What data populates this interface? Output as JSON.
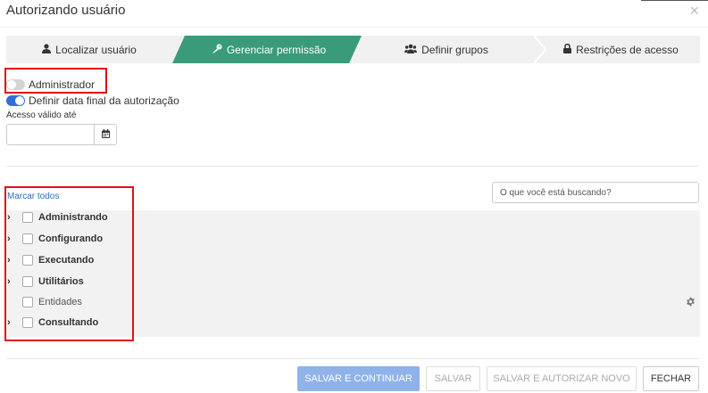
{
  "dialog": {
    "title": "Autorizando usuário",
    "close_glyph": "×"
  },
  "wizard": {
    "tabs": [
      {
        "label": "Localizar usuário",
        "icon": "user-icon",
        "active": false
      },
      {
        "label": "Gerenciar permissão",
        "icon": "key-icon",
        "active": true
      },
      {
        "label": "Definir grupos",
        "icon": "users-icon",
        "active": false
      },
      {
        "label": "Restrições de acesso",
        "icon": "lock-icon",
        "active": false
      }
    ],
    "active_color": "#3a9b7b"
  },
  "toggles": {
    "admin": {
      "label": "Administrador",
      "on": false
    },
    "end_date": {
      "label": "Definir data final da autorização",
      "on": true
    }
  },
  "valid_until": {
    "label": "Acesso válido até",
    "value": "",
    "calendar_icon": "calendar-icon"
  },
  "permissions": {
    "select_all": "Marcar todos",
    "search_placeholder": "O que você está buscando?",
    "items": [
      {
        "label": "Administrando",
        "expandable": true,
        "bold": true
      },
      {
        "label": "Configurando",
        "expandable": true,
        "bold": true
      },
      {
        "label": "Executando",
        "expandable": true,
        "bold": true
      },
      {
        "label": "Utilitários",
        "expandable": true,
        "bold": true
      },
      {
        "label": "Entidades",
        "expandable": false,
        "bold": false
      },
      {
        "label": "Consultando",
        "expandable": true,
        "bold": true
      }
    ],
    "settings_icon": "gear-icon"
  },
  "footer": {
    "save_continue": "SALVAR E CONTINUAR",
    "save": "SALVAR",
    "save_authorize_new": "SALVAR E AUTORIZAR NOVO",
    "close": "FECHAR"
  },
  "highlight_color": "#e0101a"
}
